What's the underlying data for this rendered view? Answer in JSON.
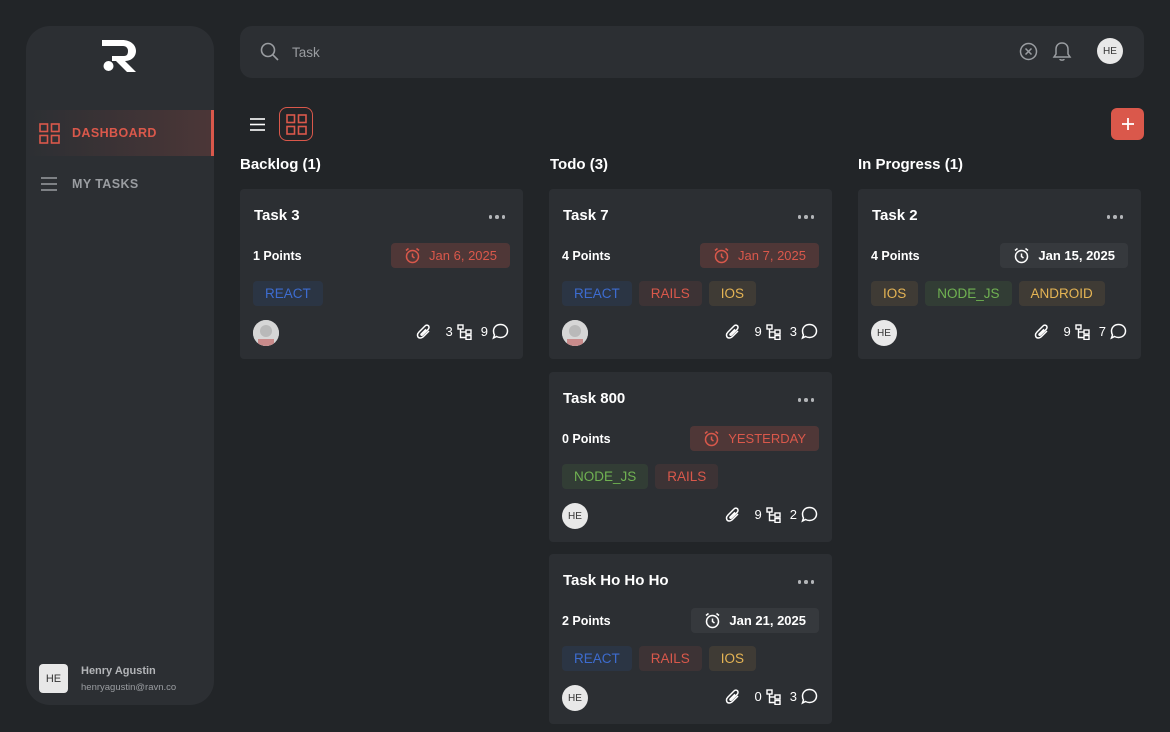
{
  "sidebar": {
    "nav": [
      {
        "label": "DASHBOARD",
        "icon": "dashboard-grid-icon",
        "active": true
      },
      {
        "label": "MY TASKS",
        "icon": "list-icon",
        "active": false
      }
    ],
    "user": {
      "initials": "HE",
      "name": "Henry Agustin",
      "email": "henryagustin@ravn.co"
    }
  },
  "topbar": {
    "search_placeholder": "Task",
    "avatar_initials": "HE"
  },
  "colors": {
    "accent": "#da584b",
    "background": "#222528",
    "surface": "#2c2f33"
  },
  "columns": [
    {
      "title": "Backlog (1)",
      "cards": [
        {
          "title": "Task 3",
          "points": "1 Points",
          "due": "Jan 6, 2025",
          "due_style": "red",
          "tags": [
            {
              "label": "REACT",
              "color": "blue"
            }
          ],
          "avatar": "",
          "attachments": "3",
          "subtasks": "9"
        }
      ]
    },
    {
      "title": "Todo (3)",
      "cards": [
        {
          "title": "Task 7",
          "points": "4 Points",
          "due": "Jan 7, 2025",
          "due_style": "red",
          "tags": [
            {
              "label": "REACT",
              "color": "blue"
            },
            {
              "label": "RAILS",
              "color": "red"
            },
            {
              "label": "IOS",
              "color": "yellow"
            }
          ],
          "avatar": "",
          "attachments": "9",
          "subtasks": "3"
        },
        {
          "title": "Task 800",
          "points": "0 Points",
          "due": "YESTERDAY",
          "due_style": "red",
          "tags": [
            {
              "label": "NODE_JS",
              "color": "green"
            },
            {
              "label": "RAILS",
              "color": "red"
            }
          ],
          "avatar": "HE",
          "attachments": "9",
          "subtasks": "2"
        },
        {
          "title": "Task Ho Ho Ho",
          "points": "2 Points",
          "due": "Jan 21, 2025",
          "due_style": "neutral",
          "tags": [
            {
              "label": "REACT",
              "color": "blue"
            },
            {
              "label": "RAILS",
              "color": "red"
            },
            {
              "label": "IOS",
              "color": "yellow"
            }
          ],
          "avatar": "HE",
          "attachments": "0",
          "subtasks": "3"
        }
      ]
    },
    {
      "title": "In Progress (1)",
      "cards": [
        {
          "title": "Task 2",
          "points": "4 Points",
          "due": "Jan 15, 2025",
          "due_style": "neutral",
          "tags": [
            {
              "label": "IOS",
              "color": "yellow"
            },
            {
              "label": "NODE_JS",
              "color": "green"
            },
            {
              "label": "ANDROID",
              "color": "yellow"
            }
          ],
          "avatar": "HE",
          "attachments": "9",
          "subtasks": "7"
        }
      ]
    }
  ]
}
